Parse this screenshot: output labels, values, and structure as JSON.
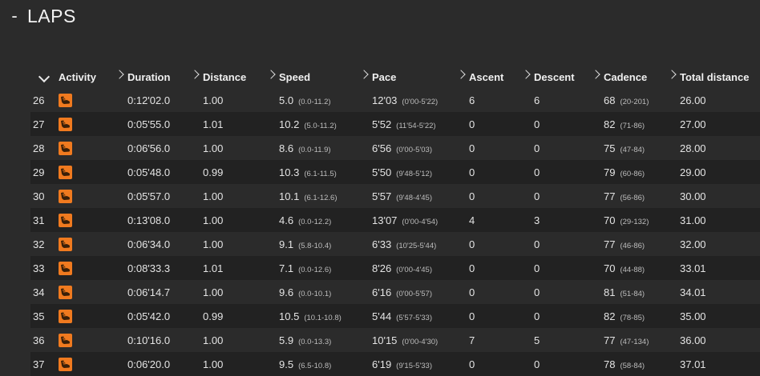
{
  "section": {
    "toggle": "-",
    "title": "LAPS"
  },
  "columns": [
    "Activity",
    "Duration",
    "Distance",
    "Speed",
    "Pace",
    "Ascent",
    "Descent",
    "Cadence",
    "Total distance"
  ],
  "icons": {
    "activity": "running-shoe-icon",
    "sort": "chevron-down-icon",
    "separator": "chevron-right-icon"
  },
  "colors": {
    "accent": "#f07a1f",
    "background": "#2b2b2b",
    "row_alt": "#222222"
  },
  "rows": [
    {
      "lap": "26",
      "duration": "0:12'02.0",
      "distance": "1.00",
      "speed": "5.0",
      "speed_range": "(0.0-11.2)",
      "pace": "12'03",
      "pace_range": "(0'00-5'22)",
      "ascent": "6",
      "descent": "6",
      "cadence": "68",
      "cadence_range": "(20-201)",
      "total": "26.00"
    },
    {
      "lap": "27",
      "duration": "0:05'55.0",
      "distance": "1.01",
      "speed": "10.2",
      "speed_range": "(5.0-11.2)",
      "pace": "5'52",
      "pace_range": "(11'54-5'22)",
      "ascent": "0",
      "descent": "0",
      "cadence": "82",
      "cadence_range": "(71-86)",
      "total": "27.00"
    },
    {
      "lap": "28",
      "duration": "0:06'56.0",
      "distance": "1.00",
      "speed": "8.6",
      "speed_range": "(0.0-11.9)",
      "pace": "6'56",
      "pace_range": "(0'00-5'03)",
      "ascent": "0",
      "descent": "0",
      "cadence": "75",
      "cadence_range": "(47-84)",
      "total": "28.00"
    },
    {
      "lap": "29",
      "duration": "0:05'48.0",
      "distance": "0.99",
      "speed": "10.3",
      "speed_range": "(6.1-11.5)",
      "pace": "5'50",
      "pace_range": "(9'48-5'12)",
      "ascent": "0",
      "descent": "0",
      "cadence": "79",
      "cadence_range": "(60-86)",
      "total": "29.00"
    },
    {
      "lap": "30",
      "duration": "0:05'57.0",
      "distance": "1.00",
      "speed": "10.1",
      "speed_range": "(6.1-12.6)",
      "pace": "5'57",
      "pace_range": "(9'48-4'45)",
      "ascent": "0",
      "descent": "0",
      "cadence": "77",
      "cadence_range": "(56-86)",
      "total": "30.00"
    },
    {
      "lap": "31",
      "duration": "0:13'08.0",
      "distance": "1.00",
      "speed": "4.6",
      "speed_range": "(0.0-12.2)",
      "pace": "13'07",
      "pace_range": "(0'00-4'54)",
      "ascent": "4",
      "descent": "3",
      "cadence": "70",
      "cadence_range": "(29-132)",
      "total": "31.00"
    },
    {
      "lap": "32",
      "duration": "0:06'34.0",
      "distance": "1.00",
      "speed": "9.1",
      "speed_range": "(5.8-10.4)",
      "pace": "6'33",
      "pace_range": "(10'25-5'44)",
      "ascent": "0",
      "descent": "0",
      "cadence": "77",
      "cadence_range": "(46-86)",
      "total": "32.00"
    },
    {
      "lap": "33",
      "duration": "0:08'33.3",
      "distance": "1.01",
      "speed": "7.1",
      "speed_range": "(0.0-12.6)",
      "pace": "8'26",
      "pace_range": "(0'00-4'45)",
      "ascent": "0",
      "descent": "0",
      "cadence": "70",
      "cadence_range": "(44-88)",
      "total": "33.01"
    },
    {
      "lap": "34",
      "duration": "0:06'14.7",
      "distance": "1.00",
      "speed": "9.6",
      "speed_range": "(0.0-10.1)",
      "pace": "6'16",
      "pace_range": "(0'00-5'57)",
      "ascent": "0",
      "descent": "0",
      "cadence": "81",
      "cadence_range": "(51-84)",
      "total": "34.01"
    },
    {
      "lap": "35",
      "duration": "0:05'42.0",
      "distance": "0.99",
      "speed": "10.5",
      "speed_range": "(10.1-10.8)",
      "pace": "5'44",
      "pace_range": "(5'57-5'33)",
      "ascent": "0",
      "descent": "0",
      "cadence": "82",
      "cadence_range": "(78-85)",
      "total": "35.00"
    },
    {
      "lap": "36",
      "duration": "0:10'16.0",
      "distance": "1.00",
      "speed": "5.9",
      "speed_range": "(0.0-13.3)",
      "pace": "10'15",
      "pace_range": "(0'00-4'30)",
      "ascent": "7",
      "descent": "5",
      "cadence": "77",
      "cadence_range": "(47-134)",
      "total": "36.00"
    },
    {
      "lap": "37",
      "duration": "0:06'20.0",
      "distance": "1.00",
      "speed": "9.5",
      "speed_range": "(6.5-10.8)",
      "pace": "6'19",
      "pace_range": "(9'15-5'33)",
      "ascent": "0",
      "descent": "0",
      "cadence": "78",
      "cadence_range": "(58-84)",
      "total": "37.01"
    }
  ]
}
